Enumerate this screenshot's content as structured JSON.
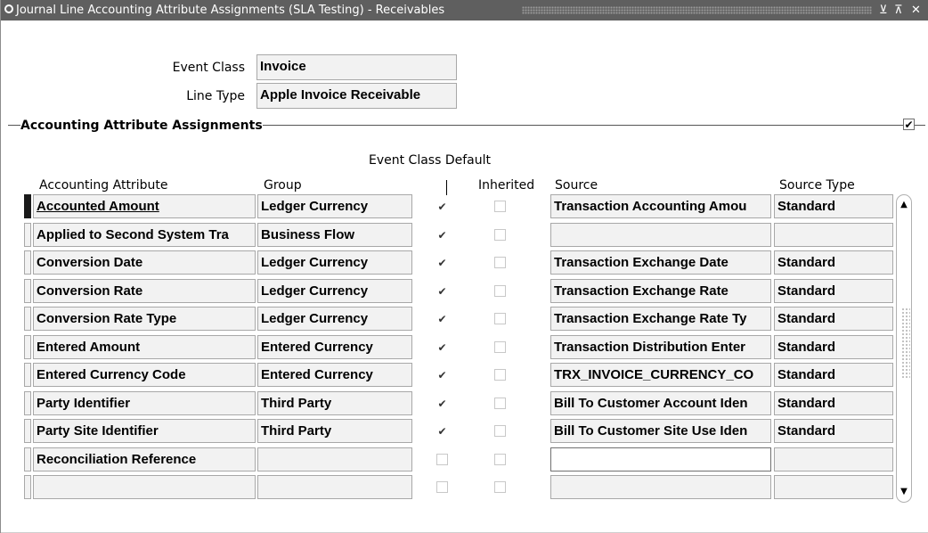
{
  "window": {
    "title": "Journal Line Accounting Attribute Assignments (SLA Testing) - Receivables",
    "minimize_glyph": "⊻",
    "maximize_glyph": "⊼",
    "close_glyph": "✕"
  },
  "form": {
    "event_class_label": "Event Class",
    "event_class_value": "Invoice",
    "line_type_label": "Line Type",
    "line_type_value": "Apple Invoice Receivable"
  },
  "section": {
    "title": "Accounting Attribute Assignments",
    "checked": true
  },
  "table": {
    "group_header": "Event Class Default",
    "columns": {
      "accounting_attribute": "Accounting Attribute",
      "group": "Group",
      "default": "|",
      "inherited": "Inherited",
      "source": "Source",
      "source_type": "Source Type"
    },
    "rows": [
      {
        "attribute": "Accounted Amount",
        "group": "Ledger Currency",
        "default": true,
        "inherited": false,
        "source": "Transaction Accounting Amou",
        "source_type": "Standard"
      },
      {
        "attribute": "Applied to Second System Tra",
        "group": "Business Flow",
        "default": true,
        "inherited": false,
        "source": "",
        "source_type": ""
      },
      {
        "attribute": "Conversion Date",
        "group": "Ledger Currency",
        "default": true,
        "inherited": false,
        "source": "Transaction Exchange Date",
        "source_type": "Standard"
      },
      {
        "attribute": "Conversion Rate",
        "group": "Ledger Currency",
        "default": true,
        "inherited": false,
        "source": "Transaction Exchange Rate",
        "source_type": "Standard"
      },
      {
        "attribute": "Conversion Rate Type",
        "group": "Ledger Currency",
        "default": true,
        "inherited": false,
        "source": "Transaction Exchange Rate Ty",
        "source_type": "Standard"
      },
      {
        "attribute": "Entered Amount",
        "group": "Entered Currency",
        "default": true,
        "inherited": false,
        "source": "Transaction Distribution Enter",
        "source_type": "Standard"
      },
      {
        "attribute": "Entered Currency Code",
        "group": "Entered Currency",
        "default": true,
        "inherited": false,
        "source": "TRX_INVOICE_CURRENCY_CO",
        "source_type": "Standard"
      },
      {
        "attribute": "Party Identifier",
        "group": "Third Party",
        "default": true,
        "inherited": false,
        "source": "Bill To Customer Account Iden",
        "source_type": "Standard"
      },
      {
        "attribute": "Party Site Identifier",
        "group": "Third Party",
        "default": true,
        "inherited": false,
        "source": "Bill To Customer Site Use Iden",
        "source_type": "Standard"
      },
      {
        "attribute": "Reconciliation Reference",
        "group": "",
        "default": false,
        "inherited": false,
        "source": "",
        "source_type": ""
      },
      {
        "attribute": "",
        "group": "",
        "default": false,
        "inherited": false,
        "source": "",
        "source_type": ""
      }
    ]
  },
  "scrollbar": {
    "up_glyph": "▲",
    "down_glyph": "▼"
  },
  "checkbox_glyph": "✔"
}
